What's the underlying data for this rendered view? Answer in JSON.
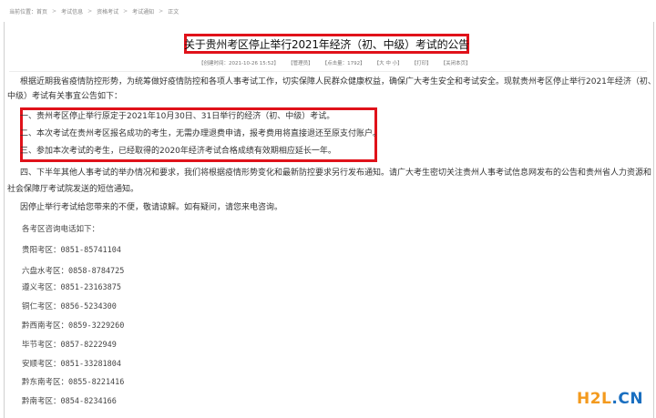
{
  "breadcrumb": [
    "当前位置：",
    "首页",
    "考试信息",
    "资格考试",
    "考试通知",
    "正文"
  ],
  "article": {
    "title": "关于贵州考区停止举行2021年经济（初、中级）考试的公告",
    "meta": {
      "date": "【创建时间：2021-10-26 15:52】",
      "author": "【管理员】",
      "views": "【点击量：1792】",
      "font_size": "【大 中 小】",
      "print": "【打印】",
      "close": "【关闭本页】"
    },
    "paragraphs": {
      "intro_line1": "根据近期我省疫情防控形势，为统筹做好疫情防控和各项人事考试工作，切实保障人民群众健康权益，确保广大考生安全和考试安全。现就贵州考区停止举行2021年经济（初、",
      "intro_line2": "中级）考试有关事宜公告如下：",
      "item1": "一、贵州考区停止举行原定于2021年10月30日、31日举行的经济（初、中级）考试。",
      "item2": "二、本次考试在贵州考区报名成功的考生，无需办理退费申请，报考费用将直接退还至原支付账户。",
      "item3": "三、参加本次考试的考生，已经取得的2020年经济考试合格成绩有效期相应延长一年。",
      "item4_line1": "四、下半年其他人事考试的举办情况和要求，我们将根据疫情形势变化和最新防控要求另行发布通知。请广大考生密切关注贵州人事考试信息网发布的公告和贵州省人力资源和",
      "item4_line2": "社会保障厅考试院发送的短信通知。",
      "apology": "因停止举行考试给您带来的不便，敬请谅解。如有疑问，请您来电咨询。"
    },
    "contacts_heading": "各考区咨询电话如下：",
    "contacts": [
      "贵阳考区：0851-85741104",
      "六盘水考区：0858-8784725",
      "遵义考区：0851-23163875",
      "铜仁考区：0856-5234300",
      "黔西南考区：0859-3229260",
      "毕节考区：0857-8222949",
      "安顺考区：0851-33281804",
      "黔东南考区：0855-8221416",
      "黔南考区：0854-8234166"
    ]
  },
  "watermark": {
    "part1": "H2L",
    "part2": ".CN"
  },
  "colors": {
    "highlight": "#e0121a",
    "watermark_orange": "#f39a1e",
    "watermark_blue": "#1a6fc0"
  }
}
